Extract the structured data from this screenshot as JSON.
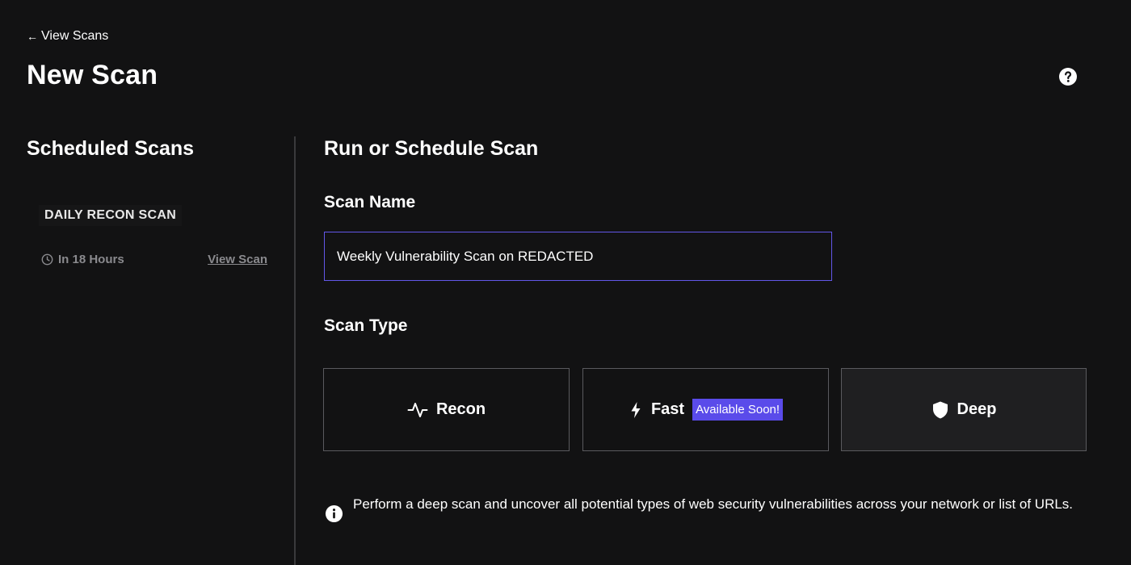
{
  "header": {
    "back_arrow": "←",
    "back_label": "View Scans",
    "title": "New Scan",
    "help_icon": "question-circle-icon"
  },
  "sidebar": {
    "title": "Scheduled Scans",
    "scans": [
      {
        "name": "DAILY RECON SCAN",
        "when": "In 18 Hours",
        "view_label": "View Scan"
      }
    ]
  },
  "main": {
    "title": "Run or Schedule Scan",
    "scan_name": {
      "label": "Scan Name",
      "value": "Weekly Vulnerability Scan on REDACTED"
    },
    "scan_type": {
      "label": "Scan Type",
      "options": [
        {
          "label": "Recon",
          "icon": "pulse-icon"
        },
        {
          "label": "Fast",
          "icon": "lightning-icon",
          "badge": "Available Soon!"
        },
        {
          "label": "Deep",
          "icon": "shield-icon"
        }
      ],
      "selected": "Deep"
    },
    "description": "Perform a deep scan and uncover all potential types of web security vulnerabilities across your network or list of URLs."
  },
  "colors": {
    "background": "#121213",
    "accent": "#5a4bea",
    "input_border": "#6257e8",
    "muted_text": "#8a8a8e",
    "selected_card": "#1f1f21"
  }
}
